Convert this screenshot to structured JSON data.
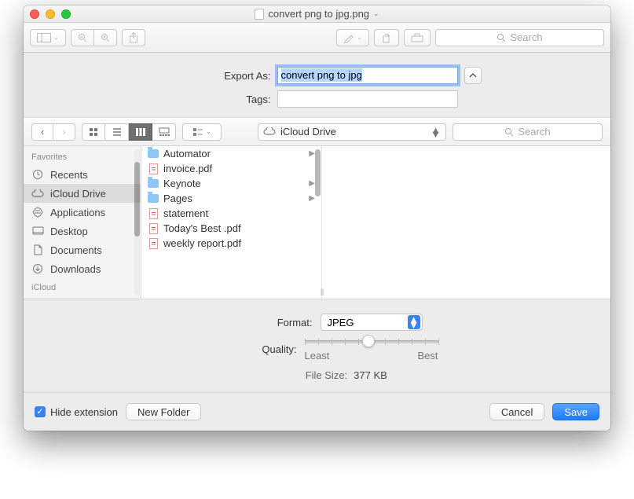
{
  "window": {
    "title": "convert png to jpg.png"
  },
  "toolbar": {
    "search_placeholder": "Search"
  },
  "export": {
    "export_as_label": "Export As:",
    "export_as_value": "convert png to jpg",
    "tags_label": "Tags:",
    "tags_value": ""
  },
  "nav": {
    "location": "iCloud Drive",
    "search_placeholder": "Search"
  },
  "sidebar": {
    "favorites_header": "Favorites",
    "items": [
      {
        "icon": "clock",
        "label": "Recents"
      },
      {
        "icon": "cloud",
        "label": "iCloud Drive",
        "selected": true
      },
      {
        "icon": "app",
        "label": "Applications"
      },
      {
        "icon": "desktop",
        "label": "Desktop"
      },
      {
        "icon": "doc",
        "label": "Documents"
      },
      {
        "icon": "download",
        "label": "Downloads"
      }
    ],
    "truncated_header": "iCloud"
  },
  "column": {
    "items": [
      {
        "type": "folder",
        "name": "Automator",
        "hasChildren": true
      },
      {
        "type": "pdf",
        "name": "invoice.pdf"
      },
      {
        "type": "folder",
        "name": "Keynote",
        "hasChildren": true
      },
      {
        "type": "folder",
        "name": "Pages",
        "hasChildren": true
      },
      {
        "type": "pdf",
        "name": "statement"
      },
      {
        "type": "pdf",
        "name": "Today's Best .pdf"
      },
      {
        "type": "pdf",
        "name": "weekly report.pdf"
      }
    ]
  },
  "format": {
    "format_label": "Format:",
    "format_value": "JPEG",
    "quality_label": "Quality:",
    "quality_least": "Least",
    "quality_best": "Best",
    "filesize_label": "File Size:",
    "filesize_value": "377 KB"
  },
  "bottom": {
    "hide_extension_label": "Hide extension",
    "hide_extension_checked": true,
    "new_folder_label": "New Folder",
    "cancel_label": "Cancel",
    "save_label": "Save"
  }
}
